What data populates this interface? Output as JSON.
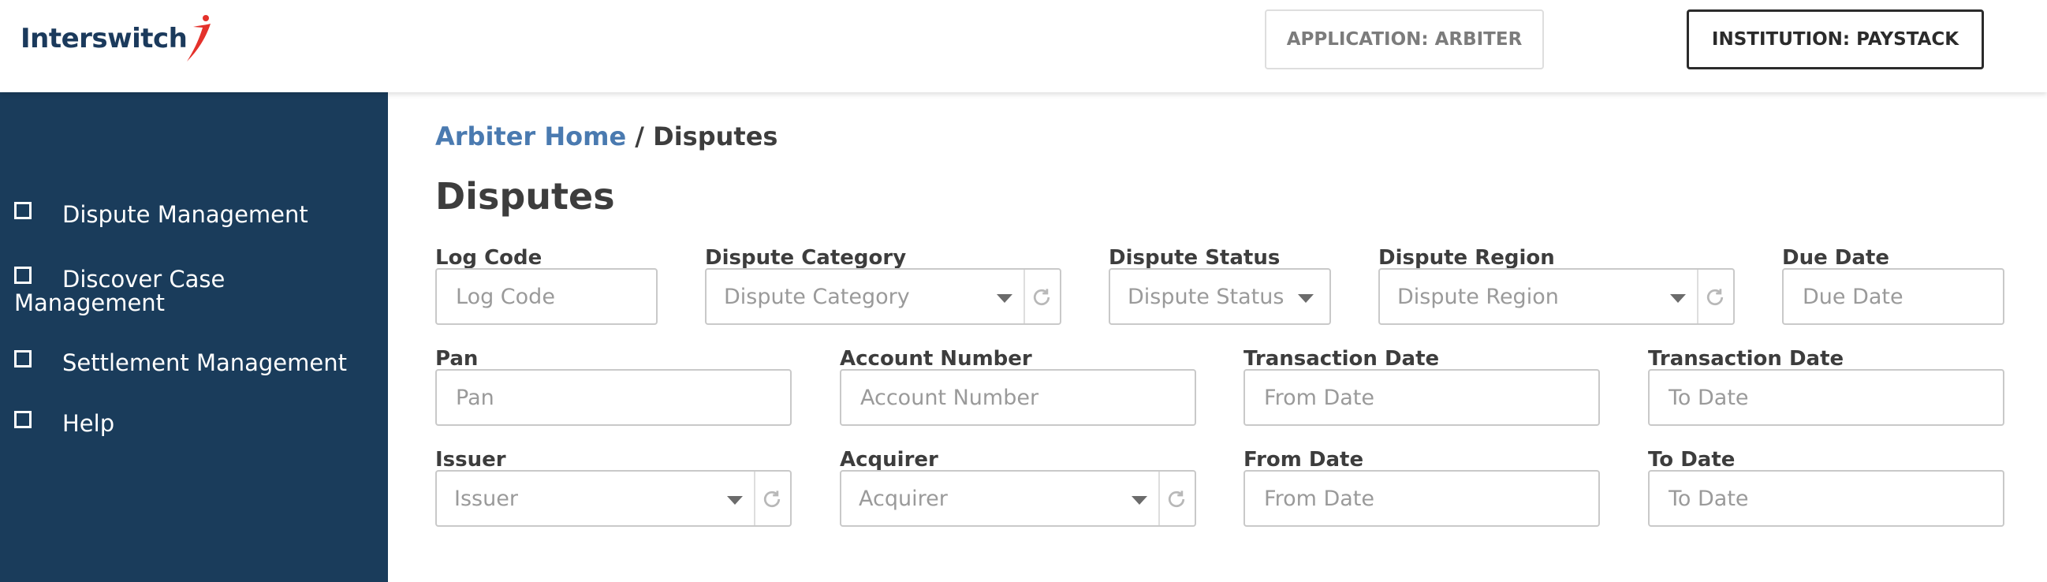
{
  "header": {
    "logo_text": "Interswitch",
    "application_label": "APPLICATION: ARBITER",
    "institution_label": "INSTITUTION: PAYSTACK"
  },
  "sidebar": {
    "items": [
      {
        "label": "Dispute Management"
      },
      {
        "label": "Discover Case Management"
      },
      {
        "label": "Settlement Management"
      },
      {
        "label": "Help"
      }
    ]
  },
  "breadcrumb": {
    "home": "Arbiter Home",
    "separator": "/",
    "current": "Disputes"
  },
  "page_title": "Disputes",
  "filters": {
    "log_code": {
      "label": "Log Code",
      "placeholder": "Log Code"
    },
    "dispute_category": {
      "label": "Dispute Category",
      "placeholder": "Dispute Category"
    },
    "dispute_status": {
      "label": "Dispute Status",
      "placeholder": "Dispute Status"
    },
    "dispute_region": {
      "label": "Dispute Region",
      "placeholder": "Dispute Region"
    },
    "due_date": {
      "label": "Due Date",
      "placeholder": "Due Date"
    },
    "pan": {
      "label": "Pan",
      "placeholder": "Pan"
    },
    "account_number": {
      "label": "Account Number",
      "placeholder": "Account Number"
    },
    "transaction_date_from": {
      "label": "Transaction Date",
      "placeholder": "From Date"
    },
    "transaction_date_to": {
      "label": "Transaction Date",
      "placeholder": "To Date"
    },
    "issuer": {
      "label": "Issuer",
      "placeholder": "Issuer"
    },
    "acquirer": {
      "label": "Acquirer",
      "placeholder": "Acquirer"
    },
    "from_date": {
      "label": "From Date",
      "placeholder": "From Date"
    },
    "to_date": {
      "label": "To Date",
      "placeholder": "To Date"
    }
  },
  "colors": {
    "sidebar_bg": "#1a3c5b",
    "link_blue": "#4a7ab0",
    "logo_navy": "#1b3a5c",
    "logo_red": "#e4312b"
  }
}
